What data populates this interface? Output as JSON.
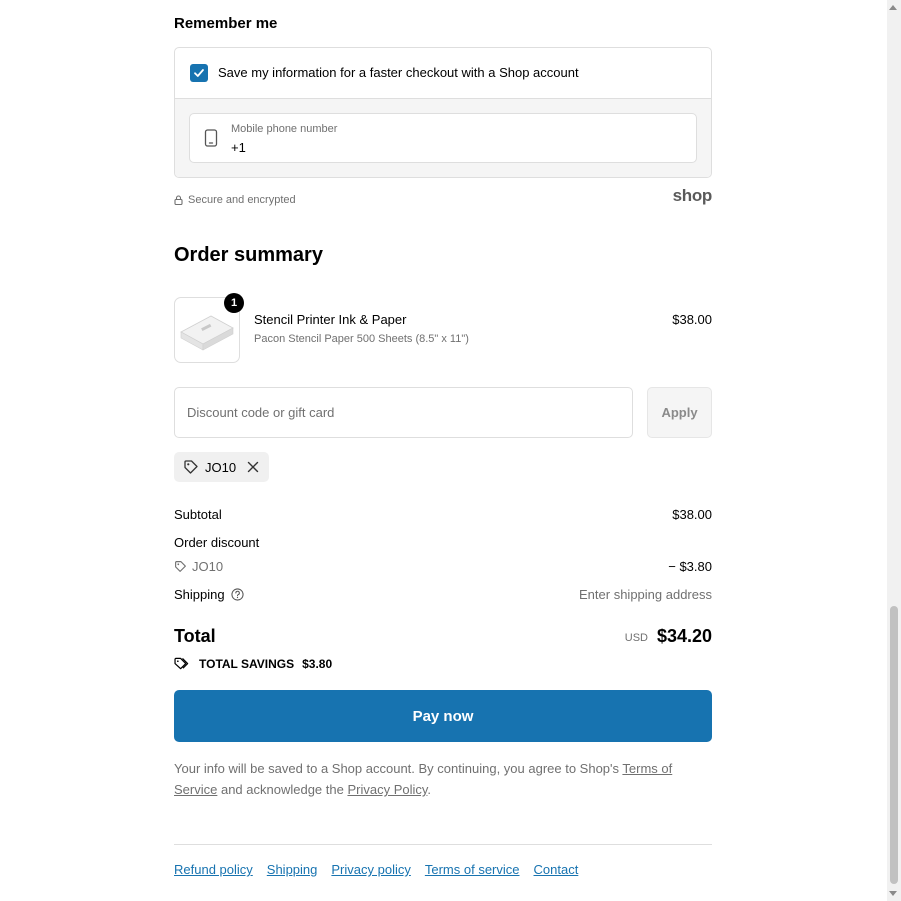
{
  "remember": {
    "title": "Remember me",
    "checkbox_label": "Save my information for a faster checkout with a Shop account",
    "checked": true,
    "phone_label": "Mobile phone number",
    "phone_value": "+1",
    "secure_text": "Secure and encrypted",
    "shop_logo": "shop"
  },
  "summary": {
    "title": "Order summary",
    "product": {
      "quantity": "1",
      "name": "Stencil Printer Ink & Paper",
      "variant": "Pacon Stencil Paper 500 Sheets (8.5\" x 11\")",
      "price": "$38.00"
    },
    "discount_placeholder": "Discount code or gift card",
    "apply_label": "Apply",
    "applied_code": "JO10",
    "subtotal_label": "Subtotal",
    "subtotal_value": "$38.00",
    "order_discount_label": "Order discount",
    "discount_code": "JO10",
    "discount_value": "− $3.80",
    "shipping_label": "Shipping",
    "shipping_value": "Enter shipping address",
    "total_label": "Total",
    "currency": "USD",
    "total_value": "$34.20",
    "savings_label": "TOTAL SAVINGS",
    "savings_value": "$3.80"
  },
  "pay": {
    "label": "Pay now",
    "legal_prefix": "Your info will be saved to a Shop account. By continuing, you agree to Shop's ",
    "terms_link": "Terms of Service",
    "legal_middle": " and acknowledge the ",
    "privacy_link": "Privacy Policy",
    "legal_suffix": "."
  },
  "footer": {
    "links": [
      "Refund policy",
      "Shipping",
      "Privacy policy",
      "Terms of service",
      "Contact"
    ]
  },
  "colors": {
    "accent": "#1773b0",
    "muted_text": "#707070",
    "border": "#dedede"
  },
  "icons": [
    "checkmark-icon",
    "phone-icon",
    "lock-icon",
    "tag-icon",
    "close-icon",
    "help-icon",
    "savings-tag-icon"
  ]
}
